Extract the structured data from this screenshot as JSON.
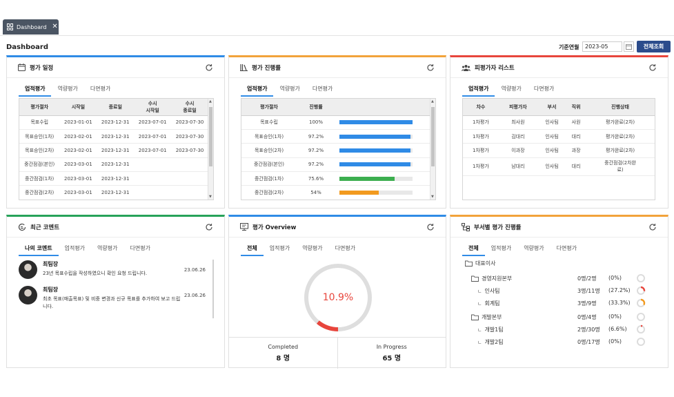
{
  "tab": {
    "label": "Dashboard"
  },
  "header": {
    "title": "Dashboard",
    "month_label": "기준연월",
    "month_value": "2023-05",
    "search_label": "전체조회"
  },
  "schedule": {
    "title": "평가 일정",
    "tabs": [
      "업적평가",
      "역량평가",
      "다면평가"
    ],
    "columns": [
      "평가절차",
      "시작일",
      "종료일",
      "수시\n시작일",
      "수시\n종료일"
    ],
    "rows": [
      [
        "목표수립",
        "2023-01-01",
        "2023-12-31",
        "2023-07-01",
        "2023-07-30"
      ],
      [
        "목표승인(1차)",
        "2023-02-01",
        "2023-12-31",
        "2023-07-01",
        "2023-07-30"
      ],
      [
        "목표승인(2차)",
        "2023-02-01",
        "2023-12-31",
        "2023-07-01",
        "2023-07-30"
      ],
      [
        "중간점검(본인)",
        "2023-03-01",
        "2023-12-31",
        "",
        ""
      ],
      [
        "중간점검(1차)",
        "2023-03-01",
        "2023-12-31",
        "",
        ""
      ],
      [
        "중간점검(2차)",
        "2023-03-01",
        "2023-12-31",
        "",
        ""
      ]
    ]
  },
  "progress": {
    "title": "평가 진행률",
    "tabs": [
      "업적평가",
      "역량평가",
      "다면평가"
    ],
    "columns": [
      "평가절차",
      "진행률",
      ""
    ],
    "rows": [
      {
        "step": "목표수립",
        "rate": "100%",
        "value": 100,
        "color": "#2f8be6"
      },
      {
        "step": "목표승인(1차)",
        "rate": "97.2%",
        "value": 97.2,
        "color": "#2f8be6"
      },
      {
        "step": "목표승인(2차)",
        "rate": "97.2%",
        "value": 97.2,
        "color": "#2f8be6"
      },
      {
        "step": "중간점검(본인)",
        "rate": "97.2%",
        "value": 97.2,
        "color": "#2f8be6"
      },
      {
        "step": "중간점검(1차)",
        "rate": "75.6%",
        "value": 75.6,
        "color": "#3cae4f"
      },
      {
        "step": "중간점검(2차)",
        "rate": "54%",
        "value": 54,
        "color": "#f29a1f"
      }
    ]
  },
  "evaluatees": {
    "title": "피평가자 리스트",
    "tabs": [
      "업적평가",
      "역량평가",
      "다면평가"
    ],
    "columns": [
      "차수",
      "피평가자",
      "부서",
      "직위",
      "진행상태"
    ],
    "rows": [
      [
        "1차평가",
        "최사원",
        "인사팀",
        "사원",
        "평가완료(2차)"
      ],
      [
        "1차평가",
        "김대리",
        "인사팀",
        "대리",
        "평가완료(2차)"
      ],
      [
        "1차평가",
        "이과장",
        "인사팀",
        "과장",
        "평가완료(2차)"
      ],
      [
        "1차평가",
        "남대리",
        "인사팀",
        "대리",
        "중간점검(2차완\n료)"
      ]
    ]
  },
  "comments": {
    "title": "최근 코멘트",
    "tabs": [
      "나의 코멘트",
      "업적평가",
      "역량평가",
      "다면평가"
    ],
    "items": [
      {
        "name": "최팀장",
        "text": "23년 목표수립을 작성하였으니 확인 요청 드립니다.",
        "date": "23.06.26"
      },
      {
        "name": "최팀장",
        "text": "최초 목표(매출목표) 및 비중 변경과 신규 목표를 추가하여 보고 드립니다.",
        "date": "23.06.26"
      }
    ]
  },
  "overview": {
    "title": "평가 Overview",
    "tabs": [
      "전체",
      "업적평가",
      "역량평가",
      "다면평가"
    ],
    "percent_label": "10.9%",
    "percent_value": 10.9,
    "ring_color": "#e8453c",
    "completed_label": "Completed",
    "completed_value": "8 명",
    "inprogress_label": "In Progress",
    "inprogress_value": "65 명"
  },
  "dept": {
    "title": "부서별 평가 진행률",
    "tabs": [
      "전체",
      "업적평가",
      "역량평가",
      "다면평가"
    ],
    "rows": [
      {
        "level": 0,
        "kind": "folder",
        "name": "대표이사",
        "count": "",
        "pct": "",
        "value": null,
        "color": ""
      },
      {
        "level": 1,
        "kind": "folder",
        "name": "경영지원본부",
        "count": "0명/2명",
        "pct": "(0%)",
        "value": 0,
        "color": "#e8453c"
      },
      {
        "level": 2,
        "kind": "leaf",
        "name": "인사팀",
        "count": "3명/11명",
        "pct": "(27.2%)",
        "value": 27.2,
        "color": "#e8453c"
      },
      {
        "level": 2,
        "kind": "leaf",
        "name": "회계팀",
        "count": "3명/9명",
        "pct": "(33.3%)",
        "value": 33.3,
        "color": "#f29a1f"
      },
      {
        "level": 1,
        "kind": "folder",
        "name": "개발본부",
        "count": "0명/4명",
        "pct": "(0%)",
        "value": 0,
        "color": "#e8453c"
      },
      {
        "level": 2,
        "kind": "leaf",
        "name": "개발1팀",
        "count": "2명/30명",
        "pct": "(6.6%)",
        "value": 6.6,
        "color": "#e8453c"
      },
      {
        "level": 2,
        "kind": "leaf",
        "name": "개발2팀",
        "count": "0명/17명",
        "pct": "(0%)",
        "value": 0,
        "color": "#e8453c"
      }
    ]
  }
}
